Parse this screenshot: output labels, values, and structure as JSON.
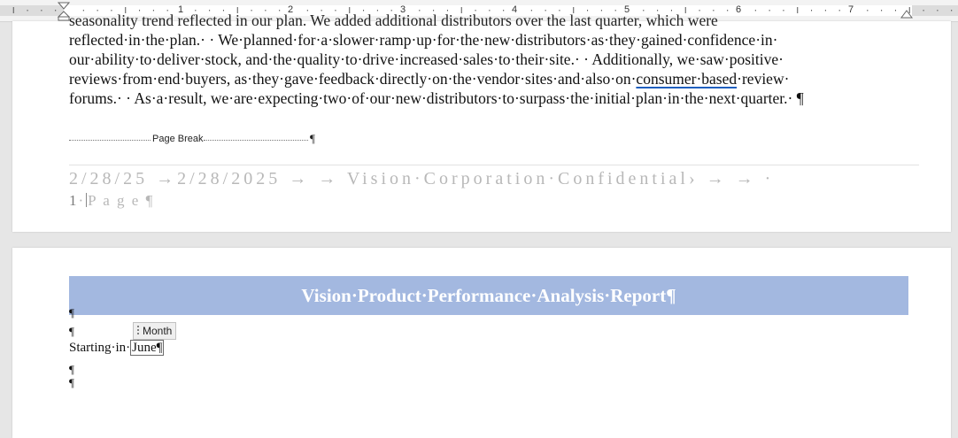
{
  "ruler": {
    "numbers": [
      "1",
      "2",
      "3",
      "4",
      "5",
      "6",
      "7"
    ]
  },
  "page1": {
    "partial_line": "seasonality trend reflected in our plan.  We added additional distributors over the last quarter, which were",
    "line1": "reflected·in·the·plan.· · We·planned·for·a·slower·ramp·up·for·the·new·distributors·as·they·gained·confidence·in·",
    "line2": "our·ability·to·deliver·stock, and·the·quality·to·drive·increased·sales·to·their·site.· · Additionally, we·saw·positive·",
    "line3_before": "reviews·from·end·buyers, as·they·gave·feedback·directly·on·the·vendor·sites·and·also·on·",
    "line3_underlined": "consumer·based",
    "line3_after": "·review·",
    "line4": "forums.· · As·a·result, we·are·expecting·two·of·our·new·distributors·to·surpass·the·initial·plan·in·the·next·quarter.· ¶",
    "page_break_label": "Page Break",
    "page_break_mark": "¶",
    "footer_line1": "2/28/25 →2/28/2025  →    →  Vision·Corporation·Confidential›  →     →  ·",
    "footer_page_num": "1",
    "footer_page_sep": "·",
    "footer_page_word": "P a g e ¶"
  },
  "page2": {
    "title": "Vision·Product·Performance·Analysis·Report¶",
    "pilcrow": "¶",
    "content_control_tag": "Month",
    "starting_label": "Starting·in·",
    "month_value": "June",
    "month_pilcrow": "¶"
  },
  "colors": {
    "title_band": "#a3b8e0",
    "footer_text": "#b8b8b8",
    "underline": "#1f5fbf"
  }
}
